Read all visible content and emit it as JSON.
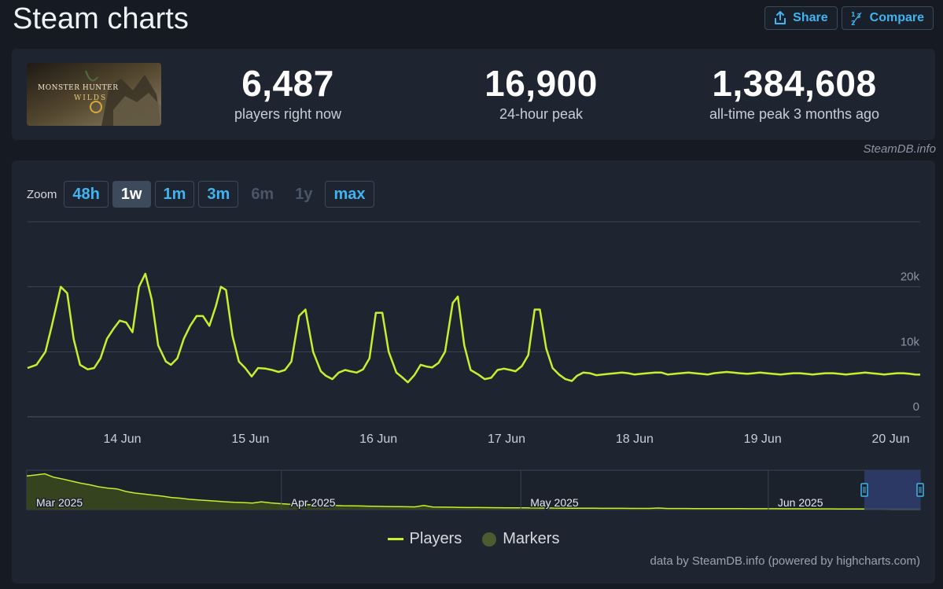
{
  "header": {
    "title": "Steam charts",
    "share_label": "Share",
    "compare_label": "Compare"
  },
  "stats": {
    "game_logo_text": "MONSTER HUNTER",
    "game_logo_sub": "WILDS",
    "current": {
      "value": "6,487",
      "label": "players right now"
    },
    "peak24": {
      "value": "16,900",
      "label": "24-hour peak"
    },
    "alltime": {
      "value": "1,384,608",
      "label": "all-time peak 3 months ago"
    }
  },
  "credit_top": "SteamDB.info",
  "zoom": {
    "label": "Zoom",
    "buttons": [
      {
        "label": "48h",
        "state": "normal"
      },
      {
        "label": "1w",
        "state": "active"
      },
      {
        "label": "1m",
        "state": "normal"
      },
      {
        "label": "3m",
        "state": "normal"
      },
      {
        "label": "6m",
        "state": "disabled"
      },
      {
        "label": "1y",
        "state": "disabled"
      },
      {
        "label": "max",
        "state": "normal"
      }
    ]
  },
  "legend": {
    "players_label": "Players",
    "markers_label": "Markers"
  },
  "credit_bottom": "data by SteamDB.info (powered by highcharts.com)",
  "colors": {
    "line": "#c5f02e",
    "navigator_fill": "#3a4a1c",
    "accent": "#3fb4f2",
    "selection": "#2f3c6a"
  },
  "chart_data": {
    "type": "line",
    "title": "",
    "xlabel": "",
    "ylabel": "",
    "ylim": [
      0,
      30000
    ],
    "y_ticks": [
      {
        "value": 0,
        "label": "0"
      },
      {
        "value": 10000,
        "label": "10k"
      },
      {
        "value": 20000,
        "label": "20k"
      }
    ],
    "x_ticks": [
      {
        "x": 0.5,
        "label": "14 Jun"
      },
      {
        "x": 1.5,
        "label": "15 Jun"
      },
      {
        "x": 2.5,
        "label": "16 Jun"
      },
      {
        "x": 3.5,
        "label": "17 Jun"
      },
      {
        "x": 4.5,
        "label": "18 Jun"
      },
      {
        "x": 5.5,
        "label": "19 Jun"
      },
      {
        "x": 6.5,
        "label": "20 Jun"
      }
    ],
    "xlim": [
      -0.24,
      6.73
    ],
    "series": [
      {
        "name": "Players",
        "x": [
          -0.24,
          -0.17,
          -0.1,
          -0.05,
          0.02,
          0.07,
          0.12,
          0.17,
          0.23,
          0.28,
          0.33,
          0.38,
          0.43,
          0.48,
          0.53,
          0.58,
          0.63,
          0.68,
          0.73,
          0.78,
          0.84,
          0.88,
          0.93,
          0.98,
          1.03,
          1.08,
          1.13,
          1.18,
          1.23,
          1.27,
          1.31,
          1.36,
          1.41,
          1.46,
          1.51,
          1.56,
          1.62,
          1.67,
          1.72,
          1.77,
          1.82,
          1.88,
          1.93,
          1.99,
          2.05,
          2.09,
          2.14,
          2.19,
          2.24,
          2.28,
          2.33,
          2.38,
          2.43,
          2.48,
          2.53,
          2.58,
          2.64,
          2.69,
          2.73,
          2.78,
          2.83,
          2.88,
          2.92,
          2.97,
          3.02,
          3.08,
          3.12,
          3.17,
          3.22,
          3.28,
          3.33,
          3.38,
          3.43,
          3.48,
          3.53,
          3.57,
          3.62,
          3.67,
          3.72,
          3.76,
          3.81,
          3.86,
          3.91,
          3.96,
          4.01,
          4.05,
          4.1,
          4.15,
          4.2,
          4.25,
          4.3,
          4.35,
          4.4,
          4.45,
          4.5,
          4.55,
          4.6,
          4.66,
          4.71,
          4.76,
          4.81,
          4.86,
          4.92,
          4.97,
          5.02,
          5.07,
          5.12,
          5.17,
          5.22,
          5.27,
          5.32,
          5.38,
          5.43,
          5.48,
          5.53,
          5.58,
          5.64,
          5.69,
          5.74,
          5.79,
          5.84,
          5.89,
          5.94,
          5.99,
          6.05,
          6.1,
          6.15,
          6.2,
          6.25,
          6.3,
          6.35,
          6.4,
          6.45,
          6.5,
          6.55,
          6.6,
          6.65,
          6.69,
          6.73
        ],
        "values": [
          7500,
          8000,
          10000,
          14000,
          20000,
          19000,
          12000,
          8000,
          7300,
          7500,
          9000,
          12000,
          13500,
          14800,
          14500,
          13000,
          20000,
          22000,
          18000,
          11000,
          8500,
          8000,
          9000,
          12000,
          14000,
          15500,
          15500,
          14000,
          17000,
          20000,
          19500,
          12500,
          8500,
          7500,
          6200,
          7500,
          7400,
          7200,
          6900,
          7200,
          8500,
          15500,
          16500,
          10000,
          7000,
          6300,
          5800,
          6800,
          7200,
          7000,
          6800,
          7300,
          9000,
          16000,
          16000,
          10000,
          6800,
          6000,
          5300,
          6400,
          8000,
          7700,
          7600,
          8300,
          10000,
          17500,
          18500,
          11000,
          7200,
          6500,
          5800,
          6000,
          7200,
          7400,
          7200,
          7000,
          7800,
          9500,
          16500,
          16500,
          10500,
          7500,
          6500,
          5800,
          5500,
          6300,
          6800,
          6700,
          6400,
          6500,
          6600,
          6700,
          6800,
          6700,
          6500,
          6600,
          6700,
          6800,
          6800,
          6500,
          6600,
          6700,
          6800,
          6700,
          6600,
          6500,
          6700,
          6800,
          6900,
          6800,
          6700,
          6600,
          6700,
          6800,
          6700,
          6600,
          6500,
          6600,
          6700,
          6700,
          6600,
          6500,
          6600,
          6700,
          6700,
          6600,
          6500,
          6600,
          6700,
          6800,
          6700,
          6600,
          6500,
          6600,
          6700,
          6700,
          6600,
          6500,
          6487
        ]
      }
    ],
    "navigator": {
      "x_ticks": [
        {
          "label": "Mar 2025"
        },
        {
          "label": "Apr 2025"
        },
        {
          "label": "May 2025"
        },
        {
          "label": "Jun 2025"
        }
      ],
      "ylim": [
        0,
        1400000
      ],
      "values": [
        1300000,
        1340000,
        1384608,
        1250000,
        1180000,
        1100000,
        1020000,
        960000,
        880000,
        830000,
        800000,
        700000,
        640000,
        600000,
        560000,
        520000,
        470000,
        440000,
        400000,
        370000,
        350000,
        330000,
        300000,
        280000,
        270000,
        250000,
        300000,
        260000,
        230000,
        210000,
        200000,
        190000,
        180000,
        170000,
        160000,
        150000,
        145000,
        140000,
        130000,
        125000,
        120000,
        115000,
        110000,
        105000,
        160000,
        100000,
        95000,
        90000,
        85000,
        80000,
        78000,
        75000,
        72000,
        70000,
        68000,
        66000,
        64000,
        62000,
        60000,
        58000,
        56000,
        55000,
        54000,
        52000,
        50000,
        49000,
        48000,
        47000,
        46000,
        45000,
        60000,
        44000,
        43000,
        42000,
        41000,
        40000,
        39000,
        38000,
        37000,
        36000,
        35000,
        34000,
        33000,
        32000,
        31000,
        30000,
        29000,
        28000,
        27000,
        26000,
        25000,
        24000,
        23000,
        22000,
        21000,
        20000,
        19000,
        18000,
        17000,
        16900
      ]
    }
  }
}
